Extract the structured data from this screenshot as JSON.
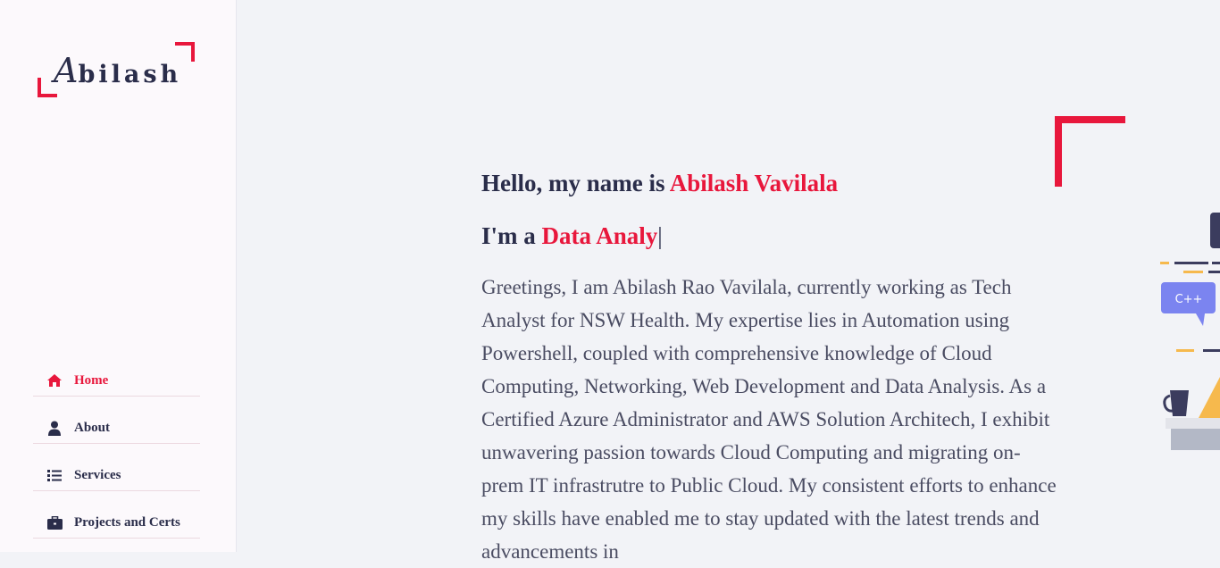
{
  "logo": {
    "initial": "A",
    "rest": "bilash"
  },
  "nav": [
    {
      "label": "Home",
      "icon": "home-icon",
      "active": true
    },
    {
      "label": "About",
      "icon": "user-icon",
      "active": false
    },
    {
      "label": "Services",
      "icon": "list-icon",
      "active": false
    },
    {
      "label": "Projects and Certs",
      "icon": "briefcase-icon",
      "active": false
    }
  ],
  "hero": {
    "greeting_prefix": "Hello, my name is ",
    "name": "Abilash Vavilala",
    "role_prefix": "I'm a ",
    "role_typed": "Data Analy",
    "cursor": "|",
    "bio": "Greetings, I am Abilash Rao Vavilala, currently working as Tech Analyst for NSW Health. My expertise lies in Automation using Powershell, coupled with comprehensive knowledge of Cloud Computing, Networking, Web Development and Data Analysis. As a Certified Azure Administrator and AWS Solution Architech, I exhibit unwavering passion towards Cloud Computing and migrating on-prem IT infrastrutre to Public Cloud. My consistent efforts to enhance my skills have enabled me to stay updated with the latest trends and advancements in"
  },
  "illustration": {
    "bubble_text": "C++"
  },
  "colors": {
    "accent": "#e8173c",
    "text": "#2a2d4a",
    "background": "#f2f3f7",
    "sidebar": "#fcf9fc"
  }
}
